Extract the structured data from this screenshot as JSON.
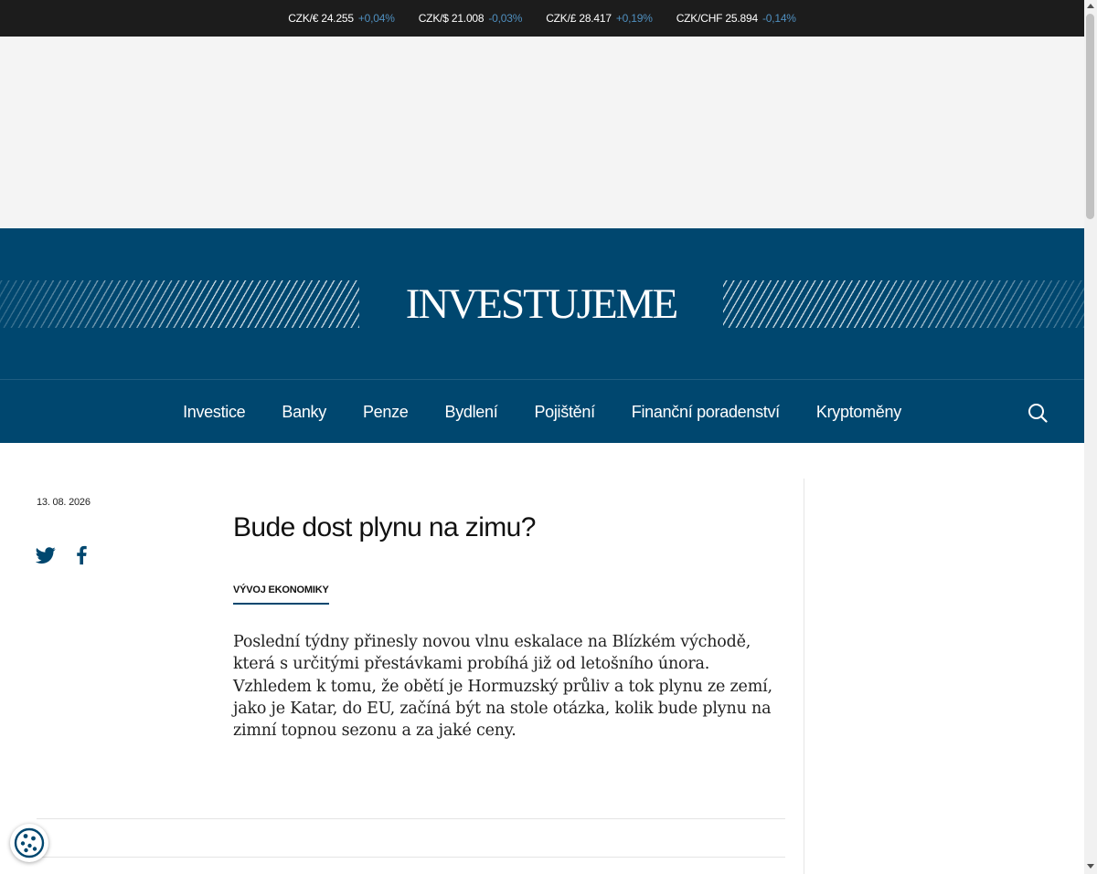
{
  "ticker": [
    {
      "label": "CZK/€ 24.255",
      "change": "+0,04%"
    },
    {
      "label": "CZK/$ 21.008",
      "change": "-0,03%"
    },
    {
      "label": "CZK/£ 28.417",
      "change": "+0,19%"
    },
    {
      "label": "CZK/CHF 25.894",
      "change": "-0,14%"
    }
  ],
  "colors": {
    "brand": "#00476f",
    "ticker_bg": "#1c1c1c",
    "ticker_change": "#4f8fbf"
  },
  "header": {
    "logo": "INVESTUJEME"
  },
  "nav": {
    "items": [
      "Investice",
      "Banky",
      "Penze",
      "Bydlení",
      "Pojištění",
      "Finanční poradenství",
      "Kryptoměny"
    ],
    "search_icon": "search-icon"
  },
  "article": {
    "date": "13. 08. 2026",
    "title": "Bude dost plynu na zimu?",
    "category": "VÝVOJ EKONOMIKY",
    "perex": "Poslední týdny přinesly novou vlnu eskalace na Blízkém východě, která s určitými přestávkami probíhá již od letošního února. Vzhledem k tomu, že obětí je Hormuzský průliv a tok plynu ze zemí, jako je Katar, do EU, začíná být na stole otázka, kolik bude plynu na zimní topnou sezonu a za jaké ceny."
  },
  "share": {
    "icons": [
      "twitter-icon",
      "facebook-icon"
    ]
  },
  "cookie": {
    "icon": "cookie-icon"
  }
}
